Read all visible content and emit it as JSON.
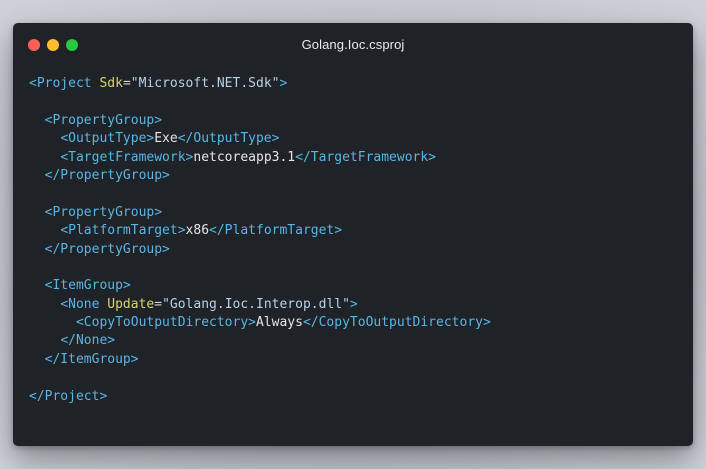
{
  "window": {
    "title": "Golang.Ioc.csproj",
    "traffic_lights": [
      {
        "name": "close-light",
        "color": "#ff5f56"
      },
      {
        "name": "minimize-light",
        "color": "#ffbd2e"
      },
      {
        "name": "maximize-light",
        "color": "#27c93f"
      }
    ]
  },
  "colors": {
    "tag": "#59b6e6",
    "attr": "#d7d66c",
    "string": "#b7d3e8",
    "text": "#e6e6e6",
    "punct": "#d4d4d4",
    "background": "#1f2227",
    "page_background": "#b8bec6"
  },
  "code": {
    "lines": [
      [
        {
          "t": "tag",
          "v": "<Project"
        },
        {
          "t": "text",
          "v": " "
        },
        {
          "t": "attr",
          "v": "Sdk"
        },
        {
          "t": "punct",
          "v": "="
        },
        {
          "t": "string",
          "v": "\"Microsoft.NET.Sdk\""
        },
        {
          "t": "tag",
          "v": ">"
        }
      ],
      [],
      [
        {
          "t": "text",
          "v": "  "
        },
        {
          "t": "tag",
          "v": "<PropertyGroup>"
        }
      ],
      [
        {
          "t": "text",
          "v": "    "
        },
        {
          "t": "tag",
          "v": "<OutputType>"
        },
        {
          "t": "text",
          "v": "Exe"
        },
        {
          "t": "tag",
          "v": "</OutputType>"
        }
      ],
      [
        {
          "t": "text",
          "v": "    "
        },
        {
          "t": "tag",
          "v": "<TargetFramework>"
        },
        {
          "t": "text",
          "v": "netcoreapp3.1"
        },
        {
          "t": "tag",
          "v": "</TargetFramework>"
        }
      ],
      [
        {
          "t": "text",
          "v": "  "
        },
        {
          "t": "tag",
          "v": "</PropertyGroup>"
        }
      ],
      [],
      [
        {
          "t": "text",
          "v": "  "
        },
        {
          "t": "tag",
          "v": "<PropertyGroup>"
        }
      ],
      [
        {
          "t": "text",
          "v": "    "
        },
        {
          "t": "tag",
          "v": "<PlatformTarget>"
        },
        {
          "t": "text",
          "v": "x86"
        },
        {
          "t": "tag",
          "v": "</PlatformTarget>"
        }
      ],
      [
        {
          "t": "text",
          "v": "  "
        },
        {
          "t": "tag",
          "v": "</PropertyGroup>"
        }
      ],
      [],
      [
        {
          "t": "text",
          "v": "  "
        },
        {
          "t": "tag",
          "v": "<ItemGroup>"
        }
      ],
      [
        {
          "t": "text",
          "v": "    "
        },
        {
          "t": "tag",
          "v": "<None"
        },
        {
          "t": "text",
          "v": " "
        },
        {
          "t": "attr",
          "v": "Update"
        },
        {
          "t": "punct",
          "v": "="
        },
        {
          "t": "string",
          "v": "\"Golang.Ioc.Interop.dll\""
        },
        {
          "t": "tag",
          "v": ">"
        }
      ],
      [
        {
          "t": "text",
          "v": "      "
        },
        {
          "t": "tag",
          "v": "<CopyToOutputDirectory>"
        },
        {
          "t": "text",
          "v": "Always"
        },
        {
          "t": "tag",
          "v": "</CopyToOutputDirectory>"
        }
      ],
      [
        {
          "t": "text",
          "v": "    "
        },
        {
          "t": "tag",
          "v": "</None>"
        }
      ],
      [
        {
          "t": "text",
          "v": "  "
        },
        {
          "t": "tag",
          "v": "</ItemGroup>"
        }
      ],
      [],
      [
        {
          "t": "tag",
          "v": "</Project>"
        }
      ]
    ]
  }
}
